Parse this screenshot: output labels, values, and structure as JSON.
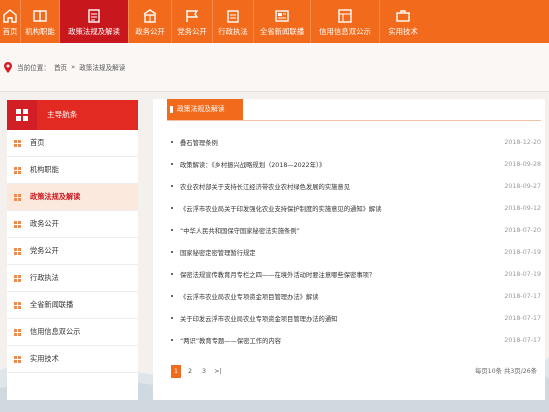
{
  "nav": {
    "items": [
      {
        "label": "首页",
        "icon": "home-icon",
        "active": false
      },
      {
        "label": "机构职能",
        "icon": "book-icon",
        "active": false
      },
      {
        "label": "政策法规及解读",
        "icon": "document-icon",
        "active": true
      },
      {
        "label": "政务公开",
        "icon": "building-icon",
        "active": false
      },
      {
        "label": "党务公开",
        "icon": "flag-icon",
        "active": false
      },
      {
        "label": "行政执法",
        "icon": "gavel-icon",
        "active": false
      },
      {
        "label": "全省新闻联播",
        "icon": "news-icon",
        "active": false
      },
      {
        "label": "信用信息双公示",
        "icon": "grid-icon",
        "active": false
      },
      {
        "label": "实用技术",
        "icon": "tools-icon",
        "active": false
      }
    ]
  },
  "breadcrumb": {
    "prefix": "当前位置：",
    "home": "首页",
    "sep": "»",
    "current": "政策法规及解读"
  },
  "sidebar": {
    "title": "主导航条",
    "items": [
      {
        "label": "首页",
        "active": false
      },
      {
        "label": "机构职能",
        "active": false
      },
      {
        "label": "政策法规及解读",
        "active": true
      },
      {
        "label": "政务公开",
        "active": false
      },
      {
        "label": "党务公开",
        "active": false
      },
      {
        "label": "行政执法",
        "active": false
      },
      {
        "label": "全省新闻联播",
        "active": false
      },
      {
        "label": "信用信息双公示",
        "active": false
      },
      {
        "label": "实用技术",
        "active": false
      }
    ]
  },
  "main": {
    "tab": "政策法规及解读",
    "articles": [
      {
        "title": "叠石管理条例",
        "date": "2018-12-20"
      },
      {
        "title": "政策解读：《乡村振兴战略规划（2018—2022年）》",
        "date": "2018-09-28"
      },
      {
        "title": "农业农村部关于支持长江经济带农业农村绿色发展的实施意见",
        "date": "2018-09-27"
      },
      {
        "title": "《云浮市农业局关于印发强化农业支持保护制度的实施意见的通知》解读",
        "date": "2018-09-12"
      },
      {
        "title": "“中华人民共和国保守国家秘密法实施条例”",
        "date": "2018-07-20"
      },
      {
        "title": "国家秘密定密管理暂行规定",
        "date": "2018-07-19"
      },
      {
        "title": "保密法规宣传教育月专栏之四——在境外活动时要注意哪些保密事项？",
        "date": "2018-07-19"
      },
      {
        "title": "《云浮市农业局农业专项资金项目管理办法》解读",
        "date": "2018-07-17"
      },
      {
        "title": "关于印发云浮市农业局农业专项资金项目管理办法的通知",
        "date": "2018-07-17"
      },
      {
        "title": "“两识”教育专题——保密工作的内容",
        "date": "2018-07-17"
      }
    ],
    "pager": {
      "pages": [
        "1",
        "2",
        "3",
        ">|"
      ],
      "current": "1",
      "info": "每页10条 共3页/26条"
    }
  },
  "colors": {
    "nav_orange": "#f26a1b",
    "nav_active_red": "#c9171e",
    "sidebar_head_red": "#e32a22"
  }
}
